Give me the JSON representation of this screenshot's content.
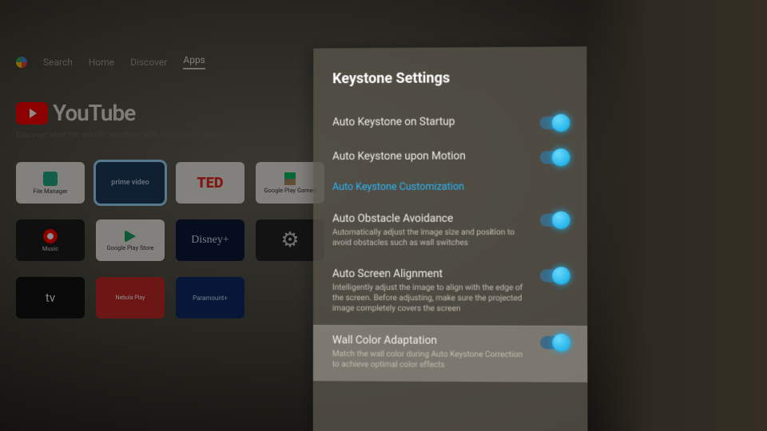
{
  "nav": {
    "search": "Search",
    "home": "Home",
    "discover": "Discover",
    "apps": "Apps"
  },
  "promo": {
    "brand": "YouTube",
    "tagline": "Discover what the world's watching with YouTube on your TV"
  },
  "apps": {
    "file_manager": "File Manager",
    "prime_video": "prime video",
    "ted": "TED",
    "google_play_games": "Google Play Games",
    "music": "Music",
    "google_play_store": "Google Play Store",
    "disney": "Disney+",
    "settings_icon": "⚙",
    "apple_tv": "tv",
    "nebula_play": "Nebula Play",
    "paramount": "Paramount+"
  },
  "panel": {
    "title": "Keystone Settings",
    "items": [
      {
        "title": "Auto Keystone on Startup",
        "desc": "",
        "on": true
      },
      {
        "title": "Auto Keystone upon Motion",
        "desc": "",
        "on": true
      },
      {
        "link": "Auto Keystone Customization"
      },
      {
        "title": "Auto Obstacle Avoidance",
        "desc": "Automatically adjust the image size and position to avoid obstacles such as wall switches",
        "on": true
      },
      {
        "title": "Auto Screen Alignment",
        "desc": "Intelligently adjust the image to align with the edge of the screen. Before adjusting, make sure the projected image completely covers the screen",
        "on": true
      },
      {
        "title": "Wall Color Adaptation",
        "desc": "Match the wall color during Auto Keystone Correction to achieve optimal color effects",
        "on": true,
        "selected": true
      }
    ]
  }
}
